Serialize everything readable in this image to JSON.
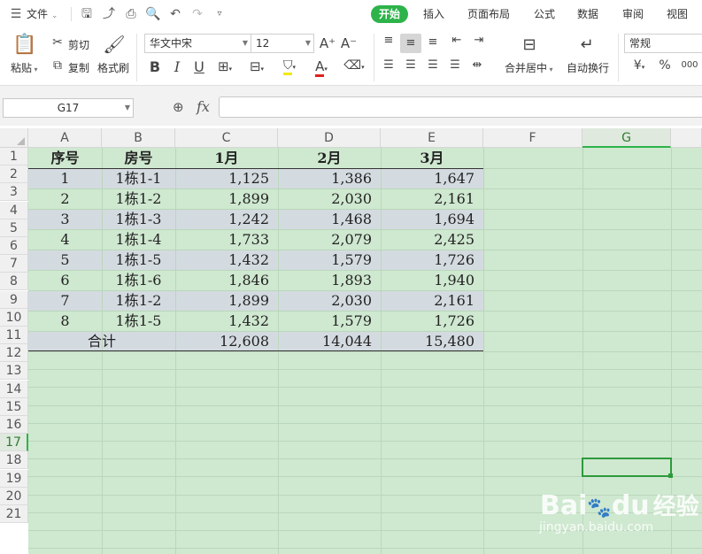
{
  "menubar": {
    "file_label": "文件",
    "tabs": [
      {
        "label": "开始",
        "active": true
      },
      {
        "label": "插入",
        "active": false
      },
      {
        "label": "页面布局",
        "active": false
      },
      {
        "label": "公式",
        "active": false
      },
      {
        "label": "数据",
        "active": false
      },
      {
        "label": "审阅",
        "active": false
      },
      {
        "label": "视图",
        "active": false
      }
    ]
  },
  "ribbon": {
    "paste_label": "粘贴",
    "cut_label": "剪切",
    "copy_label": "复制",
    "format_painter_label": "格式刷",
    "font_name": "华文中宋",
    "font_size": "12",
    "merge_center_label": "合并居中",
    "wrap_text_label": "自动换行",
    "number_format": "常规",
    "currency_symbol": "¥",
    "percent_symbol": "%",
    "comma_symbol": "000"
  },
  "formula_bar": {
    "name_box": "G17",
    "fx_label": "fx",
    "formula_value": ""
  },
  "grid": {
    "columns": [
      "A",
      "B",
      "C",
      "D",
      "E",
      "F",
      "G"
    ],
    "selected_column": "G",
    "selected_row": "17",
    "rows": [
      "1",
      "2",
      "3",
      "4",
      "5",
      "6",
      "7",
      "8",
      "9",
      "10",
      "11",
      "12",
      "13",
      "14",
      "15",
      "16",
      "17",
      "18",
      "19",
      "20",
      "21"
    ],
    "headers": [
      "序号",
      "房号",
      "1月",
      "2月",
      "3月"
    ],
    "data_rows": [
      {
        "seq": "1",
        "room": "1栋1-1",
        "jan": "1,125",
        "feb": "1,386",
        "mar": "1,647"
      },
      {
        "seq": "2",
        "room": "1栋1-2",
        "jan": "1,899",
        "feb": "2,030",
        "mar": "2,161"
      },
      {
        "seq": "3",
        "room": "1栋1-3",
        "jan": "1,242",
        "feb": "1,468",
        "mar": "1,694"
      },
      {
        "seq": "4",
        "room": "1栋1-4",
        "jan": "1,733",
        "feb": "2,079",
        "mar": "2,425"
      },
      {
        "seq": "5",
        "room": "1栋1-5",
        "jan": "1,432",
        "feb": "1,579",
        "mar": "1,726"
      },
      {
        "seq": "6",
        "room": "1栋1-6",
        "jan": "1,846",
        "feb": "1,893",
        "mar": "1,940"
      },
      {
        "seq": "7",
        "room": "1栋1-2",
        "jan": "1,899",
        "feb": "2,030",
        "mar": "2,161"
      },
      {
        "seq": "8",
        "room": "1栋1-5",
        "jan": "1,432",
        "feb": "1,579",
        "mar": "1,726"
      }
    ],
    "total": {
      "label": "合计",
      "jan": "12,608",
      "feb": "14,044",
      "mar": "15,480"
    }
  },
  "watermark": {
    "brand_latin": "Bai",
    "brand_du": "du",
    "brand_cn": "经验",
    "url": "jingyan.baidu.com"
  },
  "colors": {
    "accent": "#2db34a",
    "sheet_bg": "#cfe8d0",
    "band_bg": "#d4dbe0"
  }
}
